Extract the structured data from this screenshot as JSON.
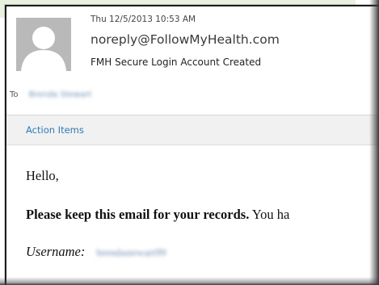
{
  "message": {
    "date": "Thu 12/5/2013 10:53 AM",
    "from": "noreply@FollowMyHealth.com",
    "subject": "FMH Secure Login Account Created",
    "to_label": "To",
    "to_value": "Brenda Stewart"
  },
  "action_bar": {
    "label": "Action Items"
  },
  "body": {
    "greeting": "Hello,",
    "keep_bold": "Please keep this email for your records.",
    "keep_rest": "You ha",
    "username_label": "Username:",
    "username_value": "brendastewart99"
  },
  "colors": {
    "link": "#2d7ab7",
    "avatar_bg": "#b9b9b9",
    "band": "#e8f2df"
  },
  "icons": {
    "avatar": "person-silhouette-icon"
  }
}
